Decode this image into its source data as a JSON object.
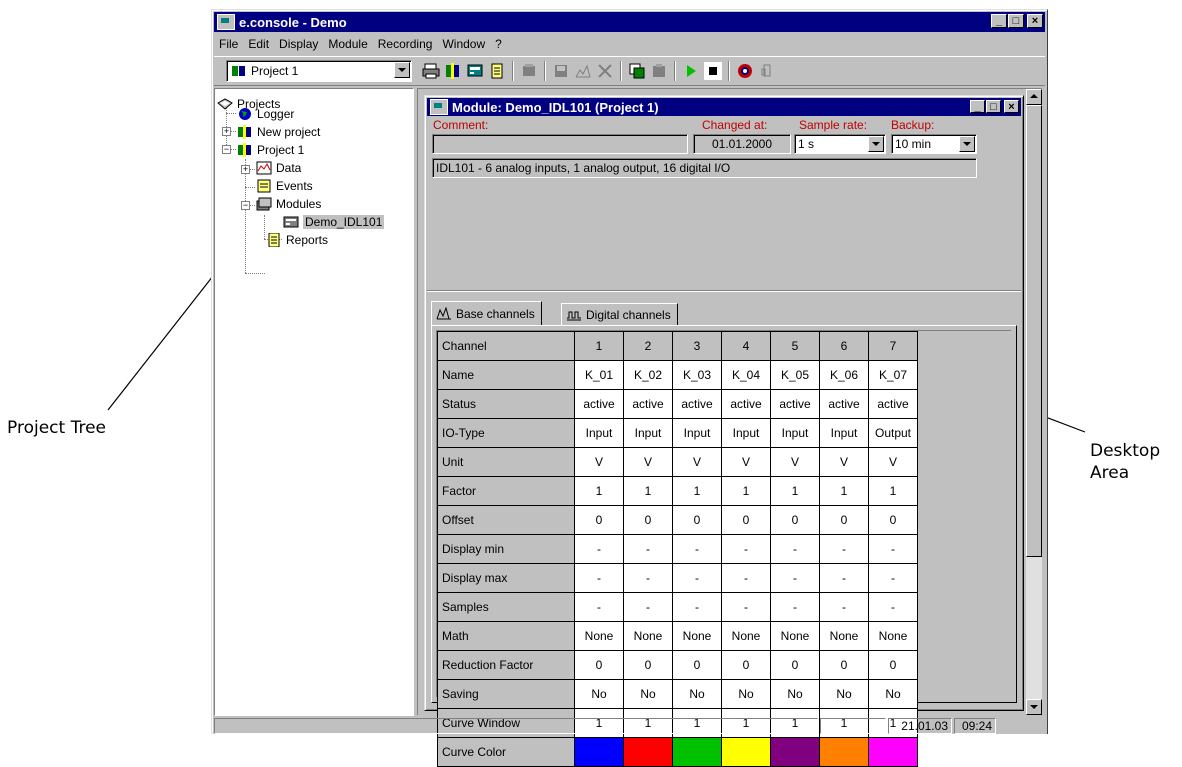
{
  "annotations": {
    "left": "Project Tree",
    "right_line1": "Desktop",
    "right_line2": "Area"
  },
  "window": {
    "title": "e.console - Demo",
    "menu": [
      "File",
      "Edit",
      "Display",
      "Module",
      "Recording",
      "Window",
      "?"
    ],
    "project_select": "Project 1"
  },
  "tree": {
    "root": "Projects",
    "items": {
      "logger": "Logger",
      "new_project": "New project",
      "project1": "Project 1",
      "data": "Data",
      "events": "Events",
      "modules": "Modules",
      "demo_module": "Demo_IDL101",
      "reports": "Reports"
    }
  },
  "module_window": {
    "title": "Module: Demo_IDL101 (Project 1)",
    "comment_label": "Comment:",
    "comment_value": "",
    "changed_label": "Changed at:",
    "changed_value": "01.01.2000",
    "sample_label": "Sample rate:",
    "sample_value": "1 s",
    "backup_label": "Backup:",
    "backup_value": "10 min",
    "description": "IDL101 - 6 analog inputs, 1 analog output, 16 digital I/O",
    "tabs": [
      "Base channels",
      "Digital channels"
    ],
    "grid": {
      "header_label": "Channel",
      "channels": [
        "1",
        "2",
        "3",
        "4",
        "5",
        "6",
        "7"
      ],
      "rows": [
        {
          "label": "Name",
          "values": [
            "K_01",
            "K_02",
            "K_03",
            "K_04",
            "K_05",
            "K_06",
            "K_07"
          ]
        },
        {
          "label": "Status",
          "values": [
            "active",
            "active",
            "active",
            "active",
            "active",
            "active",
            "active"
          ]
        },
        {
          "label": "IO-Type",
          "values": [
            "Input",
            "Input",
            "Input",
            "Input",
            "Input",
            "Input",
            "Output"
          ]
        },
        {
          "label": "Unit",
          "values": [
            "V",
            "V",
            "V",
            "V",
            "V",
            "V",
            "V"
          ]
        },
        {
          "label": "Factor",
          "values": [
            "1",
            "1",
            "1",
            "1",
            "1",
            "1",
            "1"
          ]
        },
        {
          "label": "Offset",
          "values": [
            "0",
            "0",
            "0",
            "0",
            "0",
            "0",
            "0"
          ]
        },
        {
          "label": "Display min",
          "values": [
            "-",
            "-",
            "-",
            "-",
            "-",
            "-",
            "-"
          ]
        },
        {
          "label": "Display max",
          "values": [
            "-",
            "-",
            "-",
            "-",
            "-",
            "-",
            "-"
          ]
        },
        {
          "label": "Samples",
          "values": [
            "-",
            "-",
            "-",
            "-",
            "-",
            "-",
            "-"
          ]
        },
        {
          "label": "Math",
          "values": [
            "None",
            "None",
            "None",
            "None",
            "None",
            "None",
            "None"
          ]
        },
        {
          "label": "Reduction Factor",
          "values": [
            "0",
            "0",
            "0",
            "0",
            "0",
            "0",
            "0"
          ]
        },
        {
          "label": "Saving",
          "values": [
            "No",
            "No",
            "No",
            "No",
            "No",
            "No",
            "No"
          ]
        },
        {
          "label": "Curve Window",
          "values": [
            "1",
            "1",
            "1",
            "1",
            "1",
            "1",
            "1"
          ]
        }
      ],
      "color_row_label": "Curve Color",
      "curve_colors": [
        "#0000ff",
        "#ff0000",
        "#00c000",
        "#ffff00",
        "#800080",
        "#ff8000",
        "#ff00ff"
      ]
    }
  },
  "statusbar": {
    "date": "21.01.03",
    "time": "09:24"
  }
}
